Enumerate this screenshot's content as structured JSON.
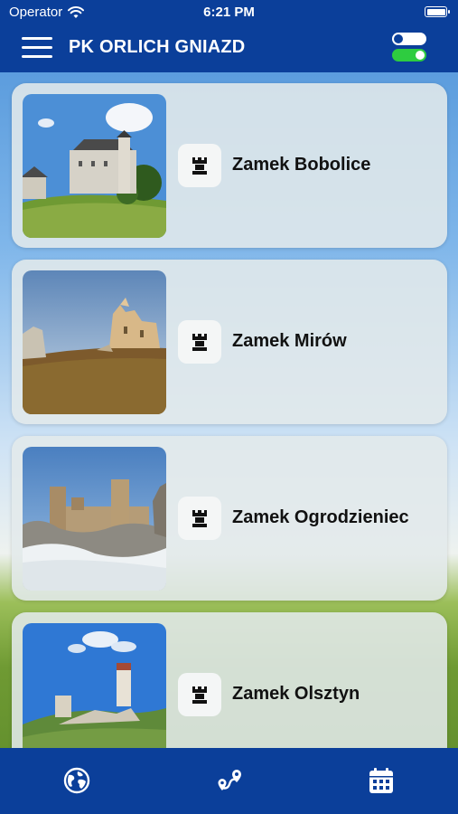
{
  "status_bar": {
    "carrier": "Operator",
    "time": "6:21 PM"
  },
  "header": {
    "title": "PK ORLICH GNIAZD",
    "menu_icon": "hamburger-menu-icon",
    "toggle_icon": "toggle-switches-icon"
  },
  "castles": [
    {
      "label": "Zamek Bobolice",
      "icon": "castle-rook-icon"
    },
    {
      "label": "Zamek Mirów",
      "icon": "castle-rook-icon"
    },
    {
      "label": "Zamek Ogrodzieniec",
      "icon": "castle-rook-icon"
    },
    {
      "label": "Zamek Olsztyn",
      "icon": "castle-rook-icon"
    }
  ],
  "tab_bar": {
    "items": [
      {
        "icon": "globe-icon"
      },
      {
        "icon": "route-icon"
      },
      {
        "icon": "calendar-icon"
      }
    ]
  },
  "colors": {
    "brand_blue": "#0b3f9a",
    "toggle_green": "#2ecc40",
    "card_background": "#e2e9eb"
  }
}
